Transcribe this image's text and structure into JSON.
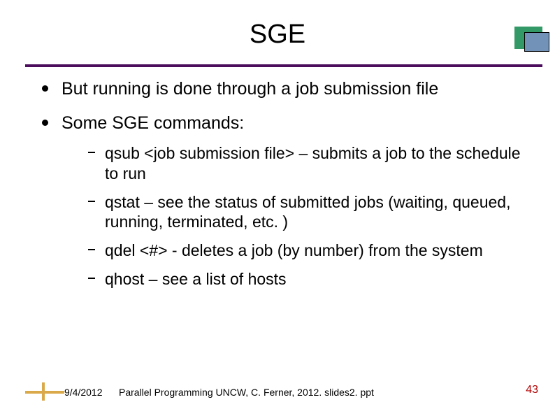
{
  "title": "SGE",
  "bullets": [
    {
      "text": "But running is done through a job submission file"
    },
    {
      "text": "Some SGE commands:"
    }
  ],
  "sub_bullets": [
    {
      "text": "qsub <job submission file> – submits a job to the schedule to run"
    },
    {
      "text": "qstat – see the status of submitted jobs (waiting, queued, running, terminated, etc. )"
    },
    {
      "text": "qdel <#> - deletes a job (by number) from the system"
    },
    {
      "text": "qhost – see a list of hosts"
    }
  ],
  "footer": {
    "date": "9/4/2012",
    "text": "Parallel Programming  UNCW, C. Ferner, 2012. slides2. ppt",
    "page": "43"
  }
}
